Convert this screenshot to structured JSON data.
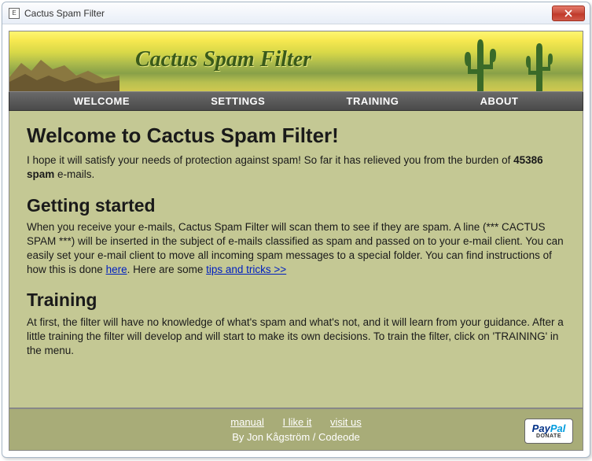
{
  "window": {
    "title": "Cactus Spam Filter"
  },
  "banner": {
    "title": "Cactus Spam Filter"
  },
  "nav": {
    "items": [
      "WELCOME",
      "SETTINGS",
      "TRAINING",
      "ABOUT"
    ]
  },
  "content": {
    "heading1": "Welcome to Cactus Spam Filter!",
    "intro_pre": "I hope it will satisfy your needs of protection against spam! So far it has relieved you from the burden of ",
    "spam_count": "45386 spam",
    "intro_post": " e-mails.",
    "heading2": "Getting started",
    "getting_started_pre": "When you receive your e-mails, Cactus Spam Filter will scan them to see if they are spam. A line (*** CACTUS SPAM ***) will be inserted in the subject of e-mails classified as spam and passed on to your e-mail client. You can easily set your e-mail client to move all incoming spam messages to a special folder. You can find instructions of how this is done ",
    "link_here": "here",
    "getting_started_mid": ". Here are some ",
    "link_tips": "tips and tricks >>",
    "heading3": "Training",
    "training_text": "At first, the filter will have no knowledge of what's spam and what's not, and it will learn from your guidance. After a little training the filter will develop and will start to make its own decisions. To train the filter, click on 'TRAINING' in the menu."
  },
  "footer": {
    "link_manual": "manual",
    "link_like": "I like it",
    "link_visit": "visit us",
    "byline": "By Jon Kågström / Codeode",
    "donate_label": "DONATE"
  }
}
